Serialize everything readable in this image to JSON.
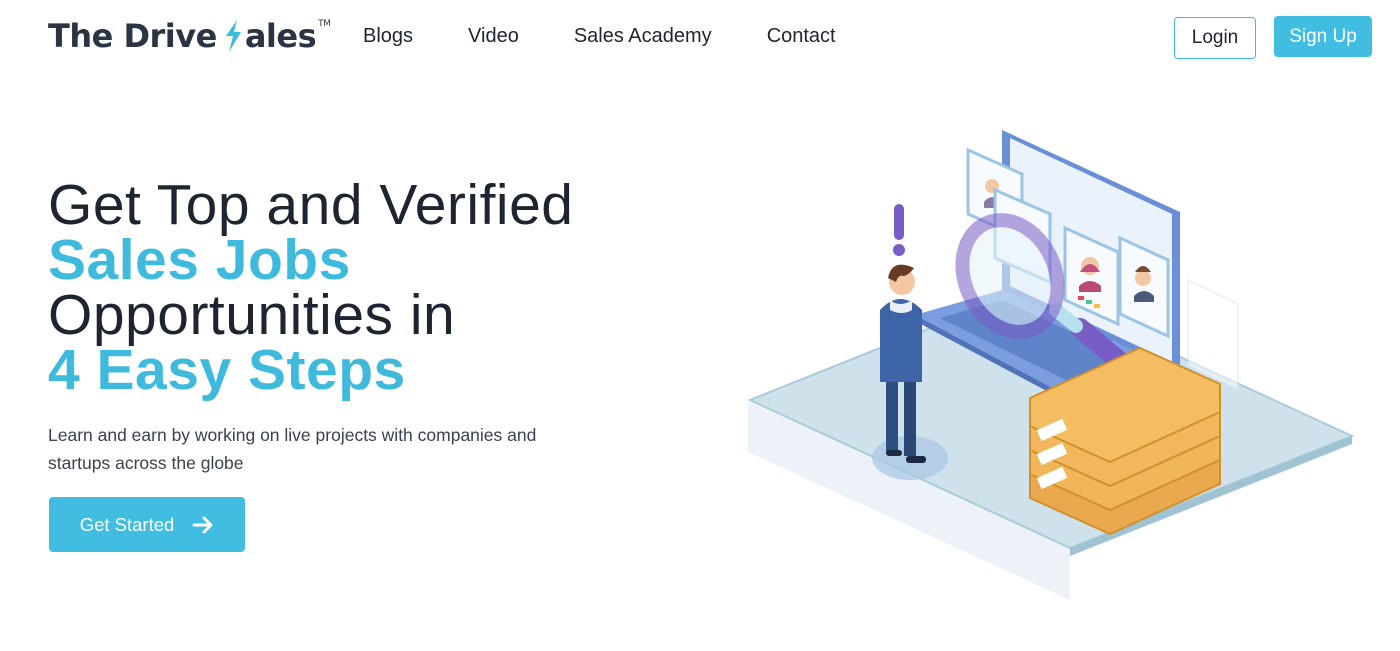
{
  "brand": {
    "name_part1": "The Drive",
    "name_part2": "ales",
    "trademark": "TM"
  },
  "nav": {
    "items": [
      {
        "label": "Blogs"
      },
      {
        "label": "Video"
      },
      {
        "label": "Sales Academy"
      },
      {
        "label": "Contact"
      }
    ]
  },
  "auth": {
    "login_label": "Login",
    "signup_label": "Sign Up"
  },
  "hero": {
    "title_line1": "Get Top and Verified",
    "title_line2": "Sales Jobs",
    "title_line3": "Opportunities in",
    "title_line4": "4 Easy Steps",
    "subtitle": "Learn and earn by working on live projects with companies and startups across the globe",
    "cta_label": "Get Started",
    "cta_icon": "arrow-right-icon"
  },
  "colors": {
    "accent": "#3fbadc",
    "text": "#1e2430",
    "illustration_purple": "#7a5cc6",
    "illustration_orange": "#eaa94e",
    "illustration_blue": "#6a8fd6"
  }
}
